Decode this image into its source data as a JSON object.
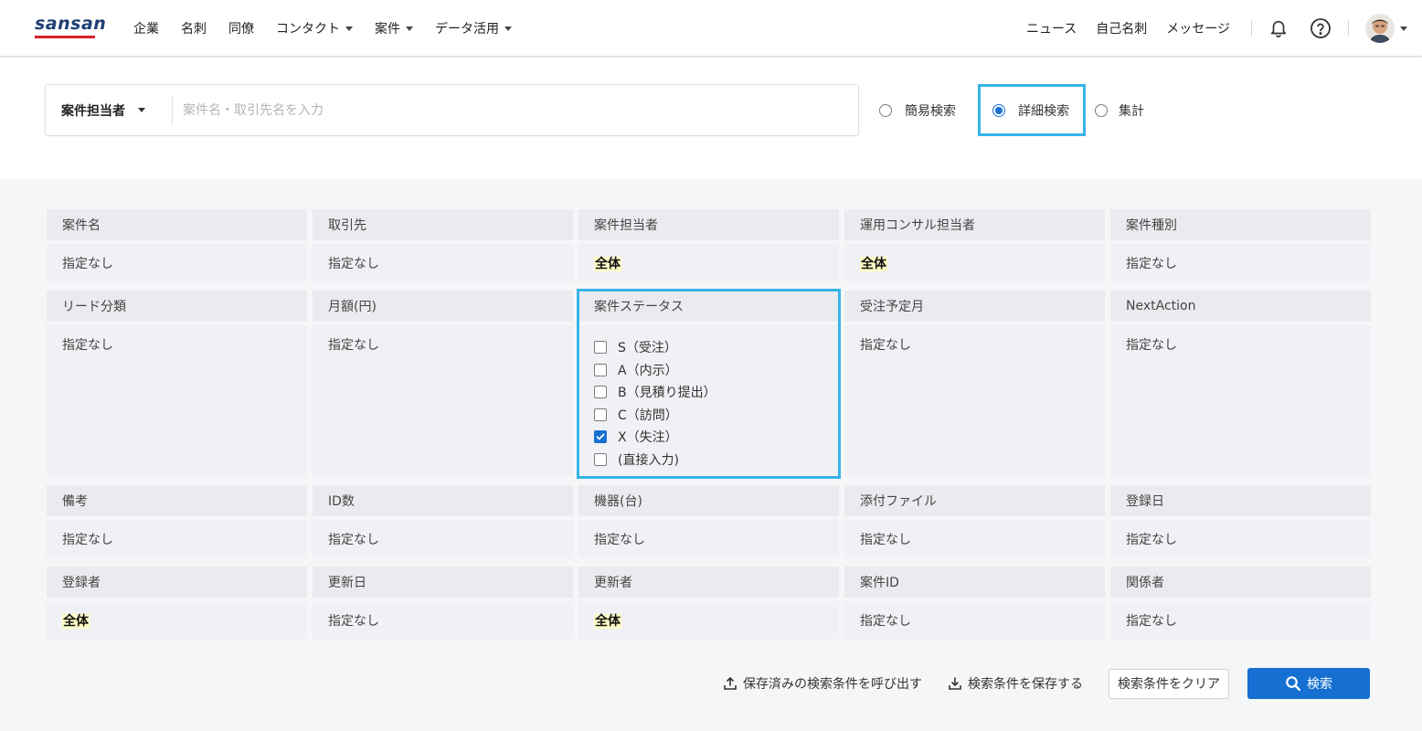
{
  "app": {
    "logo": "sansan",
    "brand_color": "#1f3f74",
    "logo_underline_color": "#d7222a"
  },
  "nav": {
    "items": [
      {
        "label": "企業",
        "dropdown": false
      },
      {
        "label": "名刺",
        "dropdown": false
      },
      {
        "label": "同僚",
        "dropdown": false
      },
      {
        "label": "コンタクト",
        "dropdown": true
      },
      {
        "label": "案件",
        "dropdown": true
      },
      {
        "label": "データ活用",
        "dropdown": true
      }
    ],
    "right": {
      "news": "ニュース",
      "my_card": "自己名刺",
      "messages": "メッセージ"
    },
    "icons": {
      "bell": "bell-icon",
      "help": "help-circle-icon",
      "avatar": "user-avatar"
    }
  },
  "search": {
    "scope_label": "案件担当者",
    "placeholder": "案件名・取引先名を入力",
    "value": "",
    "modes": {
      "simple": "簡易検索",
      "detail": "詳細検索",
      "aggregate": "集計"
    },
    "selected_mode": "detail",
    "accent": "#1670d1",
    "highlight_color": "#36b4e8"
  },
  "criteria": {
    "row1": [
      {
        "label": "案件名",
        "value": "指定なし",
        "highlight": false
      },
      {
        "label": "取引先",
        "value": "指定なし",
        "highlight": false
      },
      {
        "label": "案件担当者",
        "value": "全体",
        "highlight": true
      },
      {
        "label": "運用コンサル担当者",
        "value": "全体",
        "highlight": true
      },
      {
        "label": "案件種別",
        "value": "指定なし",
        "highlight": false
      }
    ],
    "row2": [
      {
        "label": "リード分類",
        "value": "指定なし"
      },
      {
        "label": "月額(円)",
        "value": "指定なし"
      },
      {
        "label": "案件ステータス"
      },
      {
        "label": "受注予定月",
        "value": "指定なし"
      },
      {
        "label": "NextAction",
        "value": "指定なし"
      }
    ],
    "status_options": [
      {
        "label": "S（受注）",
        "checked": false
      },
      {
        "label": "A（内示）",
        "checked": false
      },
      {
        "label": "B（見積り提出）",
        "checked": false
      },
      {
        "label": "C（訪問）",
        "checked": false
      },
      {
        "label": "X（失注）",
        "checked": true
      },
      {
        "label": "(直接入力)",
        "checked": false
      }
    ],
    "row3": [
      {
        "label": "備考",
        "value": "指定なし"
      },
      {
        "label": "ID数",
        "value": "指定なし"
      },
      {
        "label": "機器(台)",
        "value": "指定なし"
      },
      {
        "label": "添付ファイル",
        "value": "指定なし"
      },
      {
        "label": "登録日",
        "value": "指定なし"
      }
    ],
    "row4": [
      {
        "label": "登録者",
        "value": "全体",
        "highlight": true
      },
      {
        "label": "更新日",
        "value": "指定なし",
        "highlight": false
      },
      {
        "label": "更新者",
        "value": "全体",
        "highlight": true
      },
      {
        "label": "案件ID",
        "value": "指定なし",
        "highlight": false
      },
      {
        "label": "関係者",
        "value": "指定なし",
        "highlight": false
      }
    ]
  },
  "actions": {
    "load_saved": "保存済みの検索条件を呼び出す",
    "save": "検索条件を保存する",
    "clear": "検索条件をクリア",
    "search": "検索"
  }
}
